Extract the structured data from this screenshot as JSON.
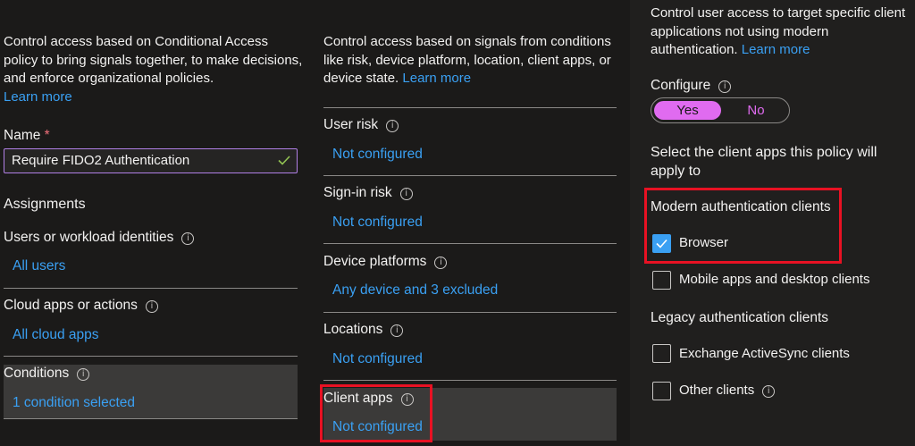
{
  "left": {
    "description": "Control access based on Conditional Access policy to bring signals together, to make decisions, and enforce organizational policies.",
    "learn_more": "Learn more",
    "name_label": "Name",
    "name_required": "*",
    "name_value": "Require FIDO2 Authentication",
    "assignments_heading": "Assignments",
    "users_label": "Users or workload identities",
    "users_value": "All users",
    "cloud_label": "Cloud apps or actions",
    "cloud_value": "All cloud apps",
    "conditions_label": "Conditions",
    "conditions_value": "1 condition selected"
  },
  "middle": {
    "description": "Control access based on signals from conditions like risk, device platform, location, client apps, or device state.",
    "learn_more": "Learn more",
    "user_risk_label": "User risk",
    "user_risk_value": "Not configured",
    "signin_risk_label": "Sign-in risk",
    "signin_risk_value": "Not configured",
    "device_platforms_label": "Device platforms",
    "device_platforms_value": "Any device and 3 excluded",
    "locations_label": "Locations",
    "locations_value": "Not configured",
    "client_apps_label": "Client apps",
    "client_apps_value": "Not configured"
  },
  "right": {
    "description": "Control user access to target specific client applications not using modern authentication.",
    "learn_more": "Learn more",
    "configure_label": "Configure",
    "toggle_yes": "Yes",
    "toggle_no": "No",
    "toggle_selected": "Yes",
    "select_text": "Select the client apps this policy will apply to",
    "modern_heading": "Modern authentication clients",
    "browser_label": "Browser",
    "browser_checked": true,
    "mobile_label": "Mobile apps and desktop clients",
    "mobile_checked": false,
    "legacy_heading": "Legacy authentication clients",
    "activesync_label": "Exchange ActiveSync clients",
    "activesync_checked": false,
    "other_label": "Other clients",
    "other_checked": false
  },
  "icons": {
    "info": "info-icon",
    "check": "check-icon"
  },
  "colors": {
    "link": "#3aa0f3",
    "toggle_accent": "#e06bf0",
    "highlight_border": "#e81123",
    "input_border": "#b180e6"
  }
}
